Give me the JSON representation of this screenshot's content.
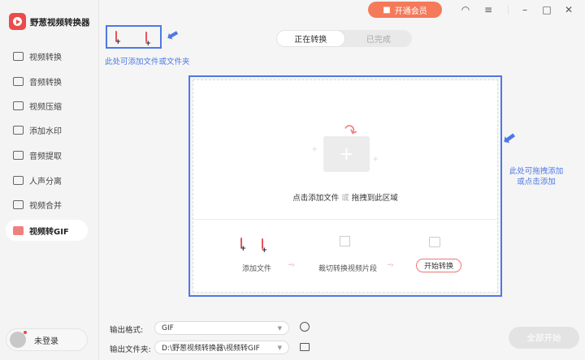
{
  "app": {
    "title": "野葱视频转换器"
  },
  "sidebar": {
    "items": [
      {
        "label": "视频转换",
        "icon": "video-convert-icon"
      },
      {
        "label": "音频转换",
        "icon": "audio-convert-icon"
      },
      {
        "label": "视频压缩",
        "icon": "video-compress-icon"
      },
      {
        "label": "添加水印",
        "icon": "watermark-icon"
      },
      {
        "label": "音频提取",
        "icon": "audio-extract-icon"
      },
      {
        "label": "人声分离",
        "icon": "vocal-separate-icon"
      },
      {
        "label": "视频合并",
        "icon": "video-merge-icon"
      },
      {
        "label": "视频转GIF",
        "icon": "gif-icon",
        "active": true
      }
    ],
    "user": "未登录"
  },
  "titlebar": {
    "vip": "开通会员"
  },
  "tabs": [
    {
      "label": "正在转换",
      "active": true
    },
    {
      "label": "已完成"
    }
  ],
  "hints": {
    "add": "此处可添加文件或文件夹",
    "drag_line1": "此处可拖拽添加",
    "drag_line2": "或点击添加"
  },
  "drop": {
    "text_a": "点击添加文件",
    "text_or": "或",
    "text_b": "拖拽到此区域"
  },
  "steps": {
    "add": "添加文件",
    "cut": "裁切转换视频片段",
    "start": "开始转换"
  },
  "output": {
    "format_label": "输出格式:",
    "format_value": "GIF",
    "folder_label": "输出文件夹:",
    "folder_value": "D:\\野葱视频转换器\\视频转GIF"
  },
  "actions": {
    "start_all": "全部开始"
  },
  "colors": {
    "accent": "#4d78e6",
    "brand": "#ea4b4b",
    "vip": "#f47a5a"
  }
}
